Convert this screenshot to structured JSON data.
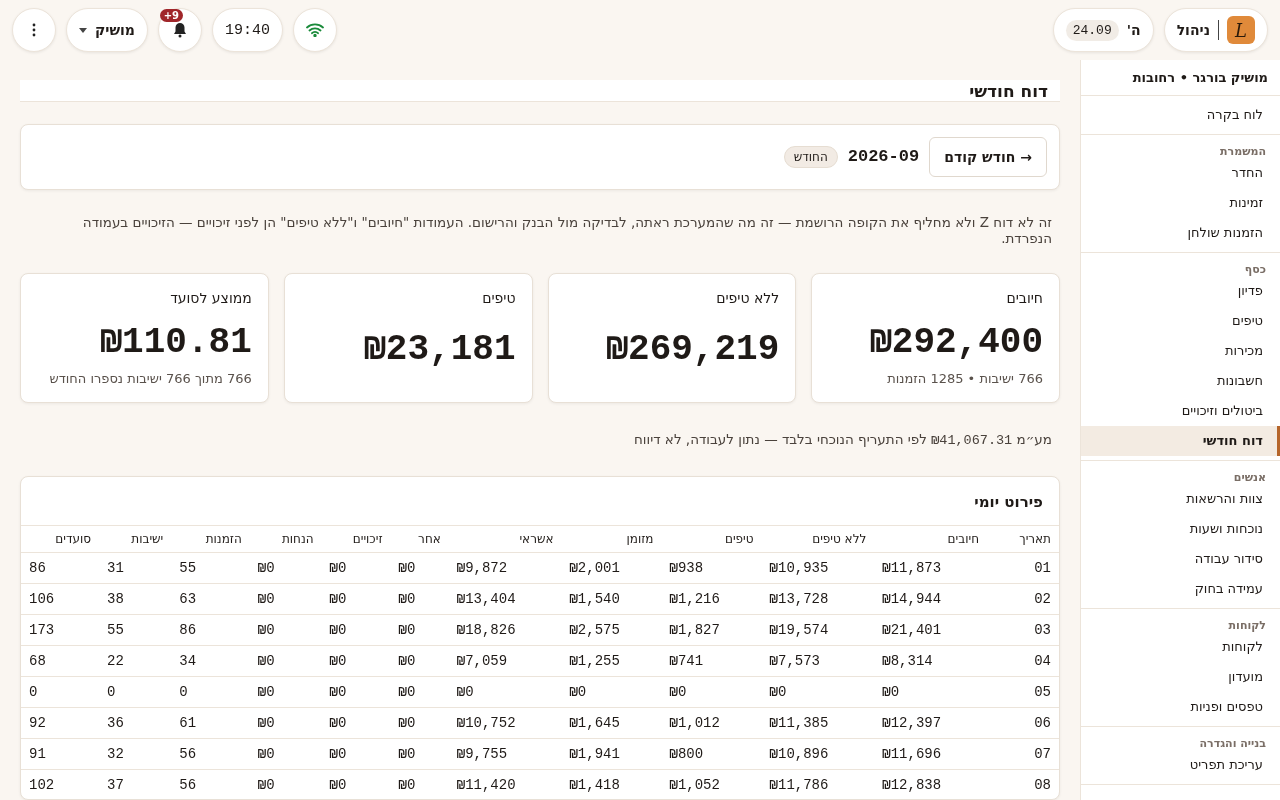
{
  "topbar": {
    "brand": {
      "label": "ניהול",
      "letter": "L"
    },
    "day": {
      "label": "ה'",
      "date": "24.09"
    },
    "wifi": {
      "connected": true
    },
    "time": "19:40",
    "notifications": {
      "badge": "+9"
    },
    "user": {
      "label": "מושיק"
    }
  },
  "sidebar": {
    "title": "מושיק בורגר • רחובות",
    "groups": [
      {
        "items": [
          {
            "label": "לוח בקרה",
            "selected": false
          }
        ]
      },
      {
        "heading": "המשמרת",
        "items": [
          {
            "label": "החדר",
            "selected": false
          },
          {
            "label": "זמינות",
            "selected": false
          },
          {
            "label": "הזמנות שולחן",
            "selected": false
          }
        ]
      },
      {
        "heading": "כסף",
        "items": [
          {
            "label": "פדיון",
            "selected": false
          },
          {
            "label": "טיפים",
            "selected": false
          },
          {
            "label": "מכירות",
            "selected": false
          },
          {
            "label": "חשבונות",
            "selected": false
          },
          {
            "label": "ביטולים וזיכויים",
            "selected": false
          },
          {
            "label": "דוח חודשי",
            "selected": true
          }
        ]
      },
      {
        "heading": "אנשים",
        "items": [
          {
            "label": "צוות והרשאות",
            "selected": false
          },
          {
            "label": "נוכחות ושעות",
            "selected": false
          },
          {
            "label": "סידור עבודה",
            "selected": false
          },
          {
            "label": "עמידה בחוק",
            "selected": false
          }
        ]
      },
      {
        "heading": "לקוחות",
        "items": [
          {
            "label": "לקוחות",
            "selected": false
          },
          {
            "label": "מועדון",
            "selected": false
          },
          {
            "label": "טפסים ופניות",
            "selected": false
          }
        ]
      },
      {
        "heading": "בנייה והגדרה",
        "items": [
          {
            "label": "עריכת תפריט",
            "selected": false
          }
        ]
      }
    ]
  },
  "page_title": "דוח חודשי",
  "month_bar": {
    "prev_button": "→ חודש קודם",
    "month": "2026-09",
    "badge": "החודש"
  },
  "note": "זה לא דוח Z ולא מחליף את הקופה הרושמת — זה מה שהמערכת ראתה, לבדיקה מול הבנק והרישום. העמודות \"חיובים\" ו\"ללא טיפים\" הן לפני זיכויים — הזיכויים בעמודה הנפרדת.",
  "stats": [
    {
      "label": "חיובים",
      "value": "₪292,400",
      "sub": "766 ישיבות • 1285 הזמנות"
    },
    {
      "label": "ללא טיפים",
      "value": "₪269,219"
    },
    {
      "label": "טיפים",
      "value": "₪23,181"
    },
    {
      "label": "ממוצע לסועד",
      "value": "₪110.81",
      "sub": "766 מתוך 766 ישיבות נספרו החודש"
    }
  ],
  "vat_note": {
    "prefix": "מע״מ",
    "amount": "₪41,067.31",
    "suffix": "לפי התעריף הנוכחי בלבד — נתון לעבודה, לא דיווח"
  },
  "table": {
    "title": "פירוט יומי",
    "columns": [
      "תאריך",
      "חיובים",
      "ללא טיפים",
      "טיפים",
      "מזומן",
      "אשראי",
      "אחר",
      "זיכויים",
      "הנחות",
      "הזמנות",
      "ישיבות",
      "סועדים"
    ],
    "rows": [
      [
        "01",
        "₪11,873",
        "₪10,935",
        "₪938",
        "₪2,001",
        "₪9,872",
        "₪0",
        "₪0",
        "₪0",
        "55",
        "31",
        "86"
      ],
      [
        "02",
        "₪14,944",
        "₪13,728",
        "₪1,216",
        "₪1,540",
        "₪13,404",
        "₪0",
        "₪0",
        "₪0",
        "63",
        "38",
        "106"
      ],
      [
        "03",
        "₪21,401",
        "₪19,574",
        "₪1,827",
        "₪2,575",
        "₪18,826",
        "₪0",
        "₪0",
        "₪0",
        "86",
        "55",
        "173"
      ],
      [
        "04",
        "₪8,314",
        "₪7,573",
        "₪741",
        "₪1,255",
        "₪7,059",
        "₪0",
        "₪0",
        "₪0",
        "34",
        "22",
        "68"
      ],
      [
        "05",
        "₪0",
        "₪0",
        "₪0",
        "₪0",
        "₪0",
        "₪0",
        "₪0",
        "₪0",
        "0",
        "0",
        "0"
      ],
      [
        "06",
        "₪12,397",
        "₪11,385",
        "₪1,012",
        "₪1,645",
        "₪10,752",
        "₪0",
        "₪0",
        "₪0",
        "61",
        "36",
        "92"
      ],
      [
        "07",
        "₪11,696",
        "₪10,896",
        "₪800",
        "₪1,941",
        "₪9,755",
        "₪0",
        "₪0",
        "₪0",
        "56",
        "32",
        "91"
      ],
      [
        "08",
        "₪12,838",
        "₪11,786",
        "₪1,052",
        "₪1,418",
        "₪11,420",
        "₪0",
        "₪0",
        "₪0",
        "56",
        "37",
        "102"
      ]
    ]
  }
}
